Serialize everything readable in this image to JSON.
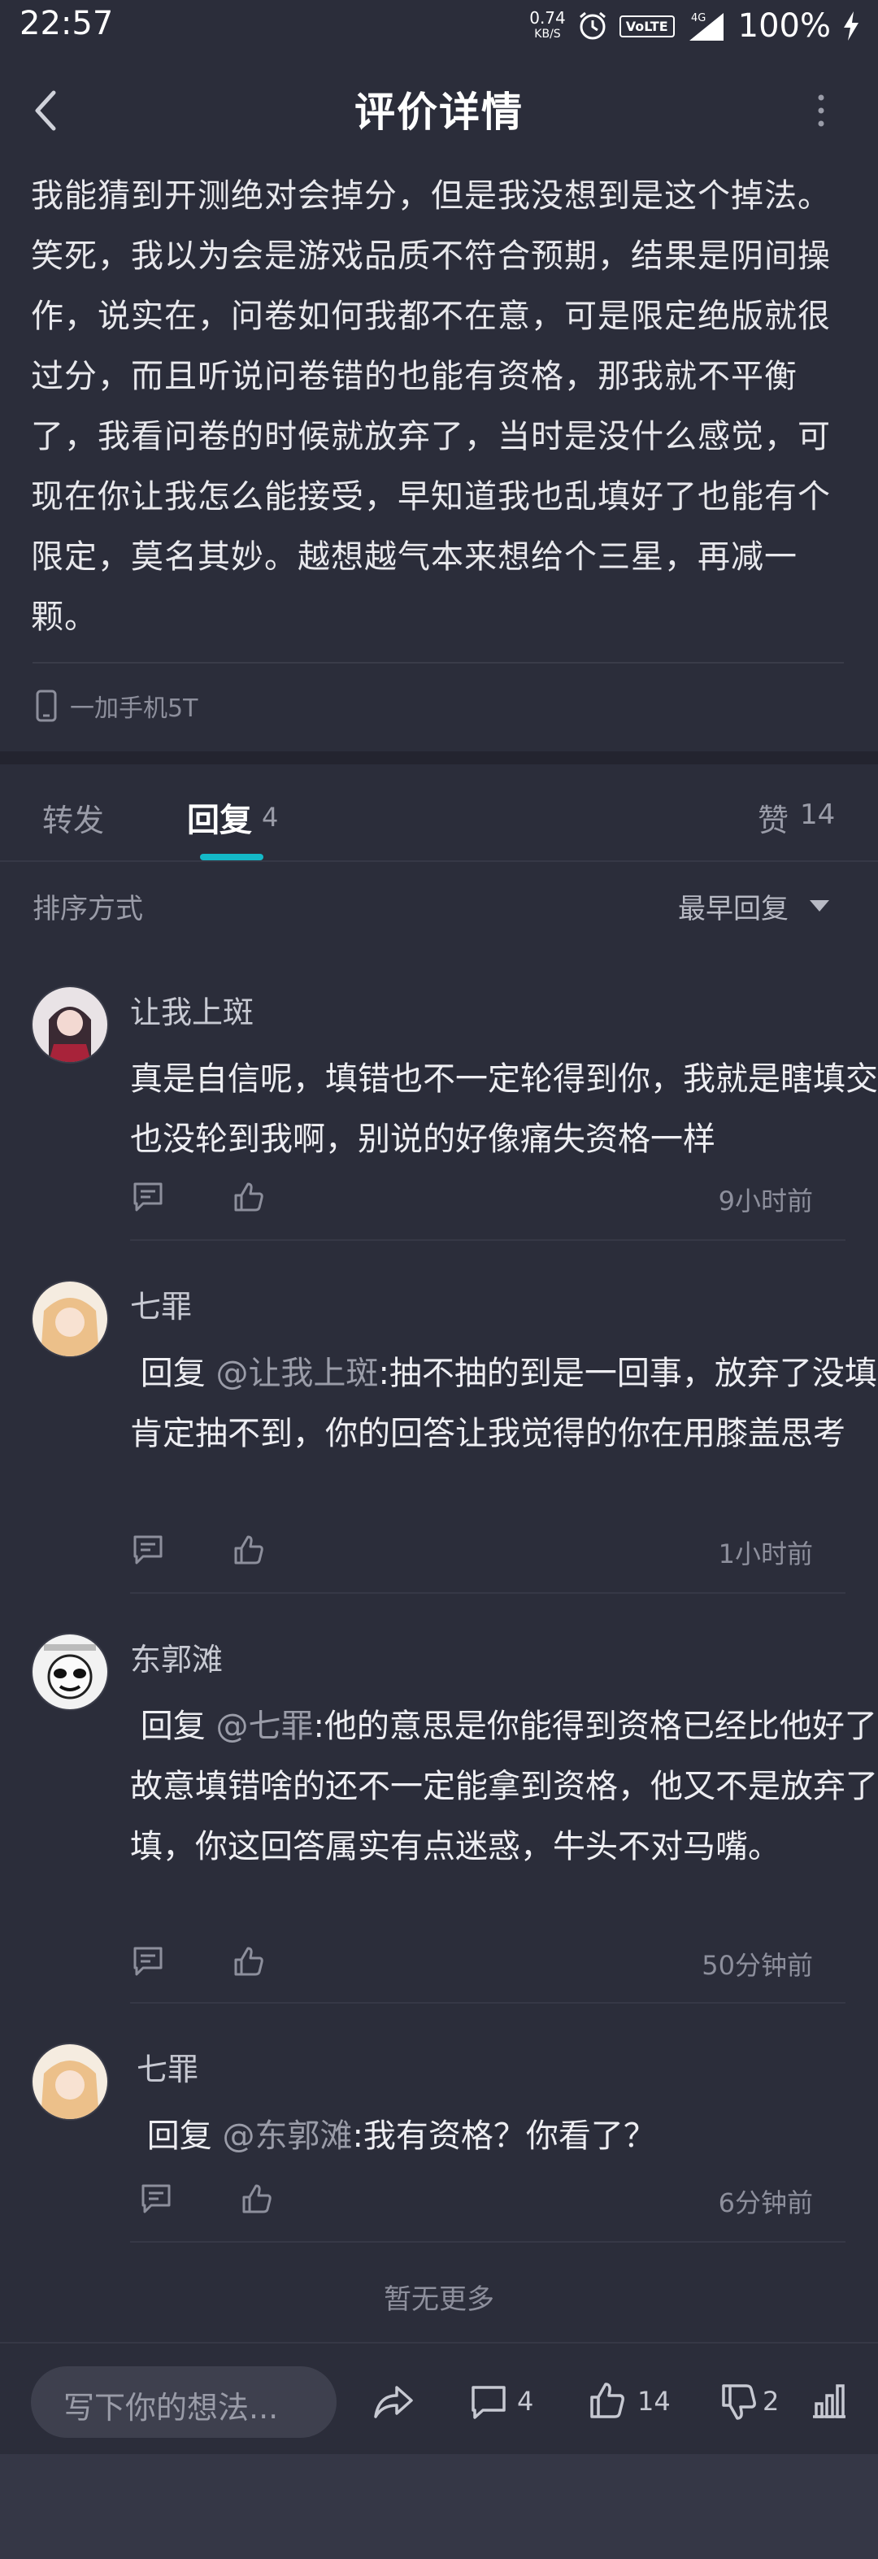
{
  "status_bar": {
    "time": "22:57",
    "speed_value": "0.74",
    "speed_unit": "KB/S",
    "volte": "VoLTE",
    "network": "4G",
    "battery": "100%"
  },
  "header": {
    "title": "评价详情"
  },
  "review": {
    "text": "我能猜到开测绝对会掉分，但是我没想到是这个掉法。笑死，我以为会是游戏品质不符合预期，结果是阴间操作，说实在，问卷如何我都不在意，可是限定绝版就很过分，而且听说问卷错的也能有资格，那我就不平衡了，我看问卷的时候就放弃了，当时是没什么感觉，可现在你让我怎么能接受，早知道我也乱填好了也能有个限定，莫名其妙。越想越气本来想给个三星，再减一颗。",
    "device": "一加手机5T"
  },
  "tabs": {
    "repost": "转发",
    "reply": "回复",
    "reply_count": "4",
    "like": "赞",
    "like_count": "14"
  },
  "sort": {
    "label": "排序方式",
    "value": "最早回复"
  },
  "comments": [
    {
      "user": "让我上斑",
      "text": "真是自信呢，填错也不一定轮得到你，我就是瞎填交了也没轮到我啊，别说的好像痛失资格一样",
      "time": "9小时前"
    },
    {
      "user": "七罪",
      "reply_prefix": "回复",
      "mention": "@让我上斑",
      "text": ":抽不抽的到是一回事，放弃了没填是肯定抽不到，你的回答让我觉得的你在用膝盖思考",
      "time": "1小时前"
    },
    {
      "user": "东郭滩",
      "reply_prefix": "回复",
      "mention": "@七罪",
      "text": ":他的意思是你能得到资格已经比他好了，故意填错啥的还不一定能拿到资格，他又不是放弃了没填，你这回答属实有点迷惑，牛头不对马嘴。",
      "time": "50分钟前"
    },
    {
      "user": "七罪",
      "reply_prefix": "回复",
      "mention": "@东郭滩",
      "text": ":我有资格？你看了？",
      "time": "6分钟前"
    }
  ],
  "no_more": "暂无更多",
  "bottom_bar": {
    "input_placeholder": "写下你的想法...",
    "comment_count": "4",
    "like_count": "14",
    "dislike_count": "2"
  },
  "colors": {
    "background": "#2b2d3a",
    "accent": "#14b9c8",
    "muted_text": "#9a9ca8"
  }
}
